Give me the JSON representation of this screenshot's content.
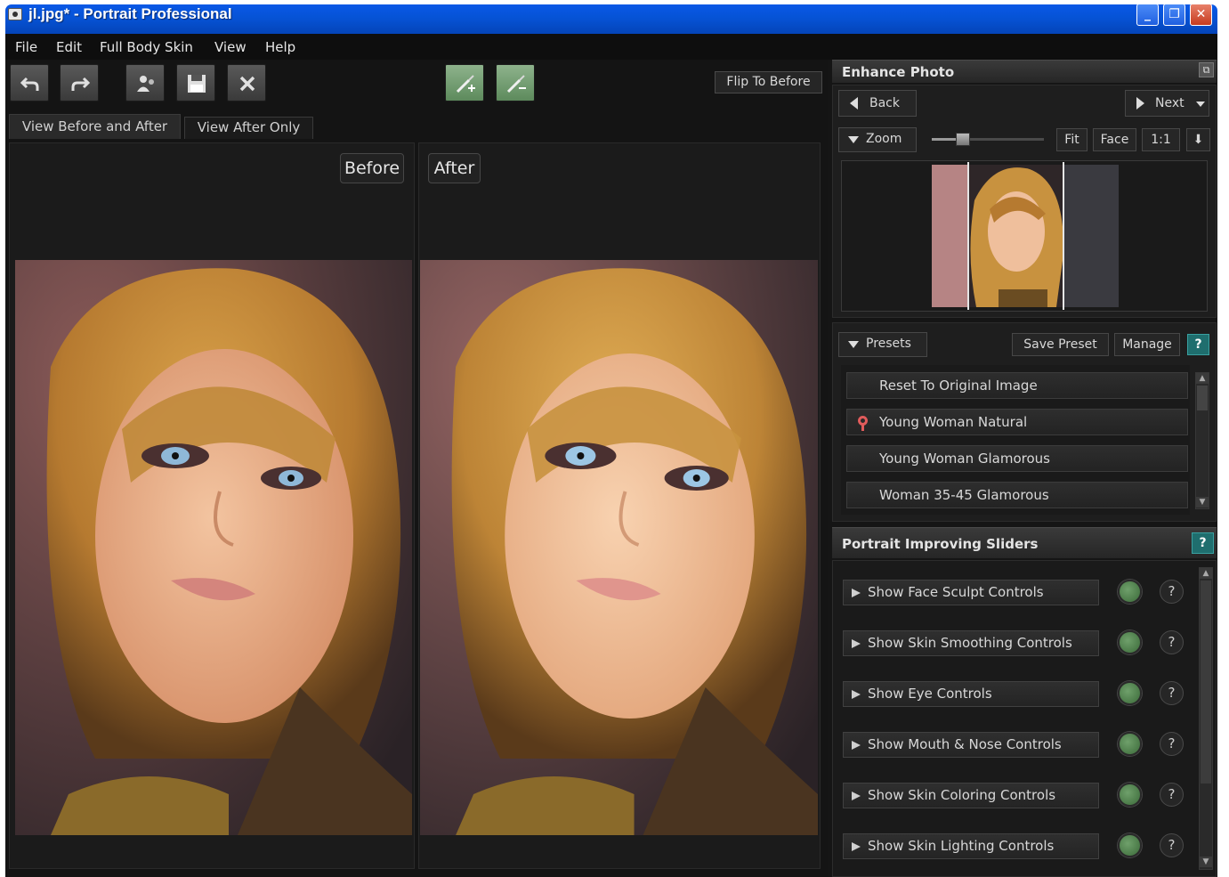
{
  "window": {
    "title": "jl.jpg* - Portrait Professional",
    "app_icon": "camera-icon",
    "controls": {
      "minimize": "_",
      "maximize": "❐",
      "close": "✕"
    }
  },
  "menu": [
    "File",
    "Edit",
    "Full Body Skin",
    "View",
    "Help"
  ],
  "toolbar": {
    "buttons": [
      "undo-icon",
      "redo-icon",
      "person-icon",
      "save-icon",
      "close-icon",
      "brush-add-icon",
      "brush-remove-icon"
    ],
    "flip_label": "Flip To Before"
  },
  "view_tabs": [
    "View Before and After",
    "View After Only"
  ],
  "panes": {
    "before_label": "Before",
    "after_label": "After"
  },
  "enhance": {
    "header": "Enhance Photo",
    "back_label": "Back",
    "next_label": "Next",
    "zoom_label": "Zoom",
    "zoom_level": 0.28,
    "fit_label": "Fit",
    "face_label": "Face",
    "one_label": "1:1"
  },
  "presets": {
    "label": "Presets",
    "save_label": "Save Preset",
    "manage_label": "Manage",
    "help": "?",
    "items": [
      "Reset To Original Image",
      "Young Woman Natural",
      "Young Woman Glamorous",
      "Woman 35-45 Glamorous"
    ]
  },
  "sliders": {
    "header": "Portrait Improving Sliders",
    "help": "?",
    "items": [
      {
        "label": "Show Face Sculpt Controls",
        "help": "?"
      },
      {
        "label": "Show Skin Smoothing Controls",
        "help": "?"
      },
      {
        "label": "Show Eye Controls",
        "help": "?"
      },
      {
        "label": "Show Mouth & Nose Controls",
        "help": "?"
      },
      {
        "label": "Show Skin Coloring Controls",
        "help": "?"
      },
      {
        "label": "Show Skin Lighting Controls",
        "help": "?"
      }
    ]
  },
  "colors": {
    "accent_green": "#5d8a5c",
    "help_teal": "#1f6e6e",
    "title_blue": "#0653d6"
  }
}
